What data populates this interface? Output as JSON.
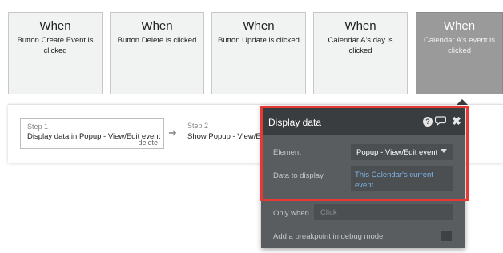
{
  "events": [
    {
      "when": "When",
      "description": "Button Create Event is clicked"
    },
    {
      "when": "When",
      "description": "Button Delete is clicked"
    },
    {
      "when": "When",
      "description": "Button Update is clicked"
    },
    {
      "when": "When",
      "description": "Calendar A's day is clicked"
    },
    {
      "when": "When",
      "description": "Calendar A's event is clicked",
      "selected": true
    }
  ],
  "workflow": {
    "step1": {
      "number": "Step 1",
      "title": "Display data in Popup - View/Edit event",
      "delete_label": "delete"
    },
    "step2": {
      "number": "Step 2",
      "title": "Show Popup - View/Edit event"
    }
  },
  "panel": {
    "title": "Display data",
    "help_icon": "?",
    "element_label": "Element",
    "element_value": "Popup - View/Edit event",
    "data_label": "Data to display",
    "data_value": "This Calendar's current event",
    "only_when_label": "Only when",
    "only_when_placeholder": "Click",
    "breakpoint_label": "Add a breakpoint in debug mode"
  },
  "colors": {
    "highlight": "#e53935",
    "panel_bg": "#595d60",
    "panel_header": "#3a3d3f",
    "link_blue": "#7fb3e8"
  }
}
